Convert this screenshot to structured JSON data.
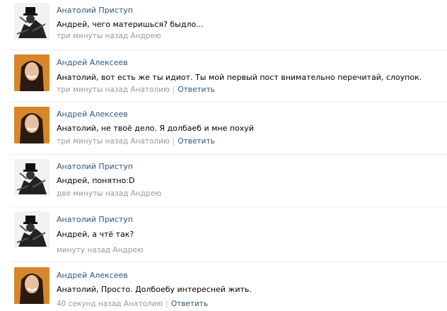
{
  "comments": [
    {
      "author": "Анатолий Приступ",
      "avatar": "woodcut-man-avatar",
      "text": "Андрей, чего материшься? быдло...",
      "time": "три минуты назад Андрею",
      "reply": ""
    },
    {
      "author": "Андрей Алексеев",
      "avatar": "girl-photo-avatar",
      "text": "Анатолий, вот есть же ты идиот. Ты мой первый пост внимательно перечитай, слоупок.",
      "time": "три минуты назад Анатолию",
      "reply": "Ответить"
    },
    {
      "author": "Андрей Алексеев",
      "avatar": "girl-photo-avatar",
      "text": "Анатолий, не твоё дело. Я долбаеб и мне похуй",
      "time": "три минуты назад Анатолию",
      "reply": "Ответить"
    },
    {
      "author": "Анатолий Приступ",
      "avatar": "woodcut-man-avatar",
      "text": "Андрей, понятно:D",
      "time": "две минуты назад Андрею",
      "reply": ""
    },
    {
      "author": "Анатолий Приступ",
      "avatar": "woodcut-man-avatar",
      "text": "Андрей, а чтё так?",
      "time": "минуту назад Андрею",
      "reply": ""
    },
    {
      "author": "Андрей Алексеев",
      "avatar": "girl-photo-avatar",
      "text": "Анатолий, Просто. Долбоебу интересней жить.",
      "time": "40 секунд назад Анатолию",
      "reply": "Ответить"
    }
  ],
  "colors": {
    "link": "#2b587a",
    "meta": "#999999",
    "divider": "#e8ebef"
  }
}
